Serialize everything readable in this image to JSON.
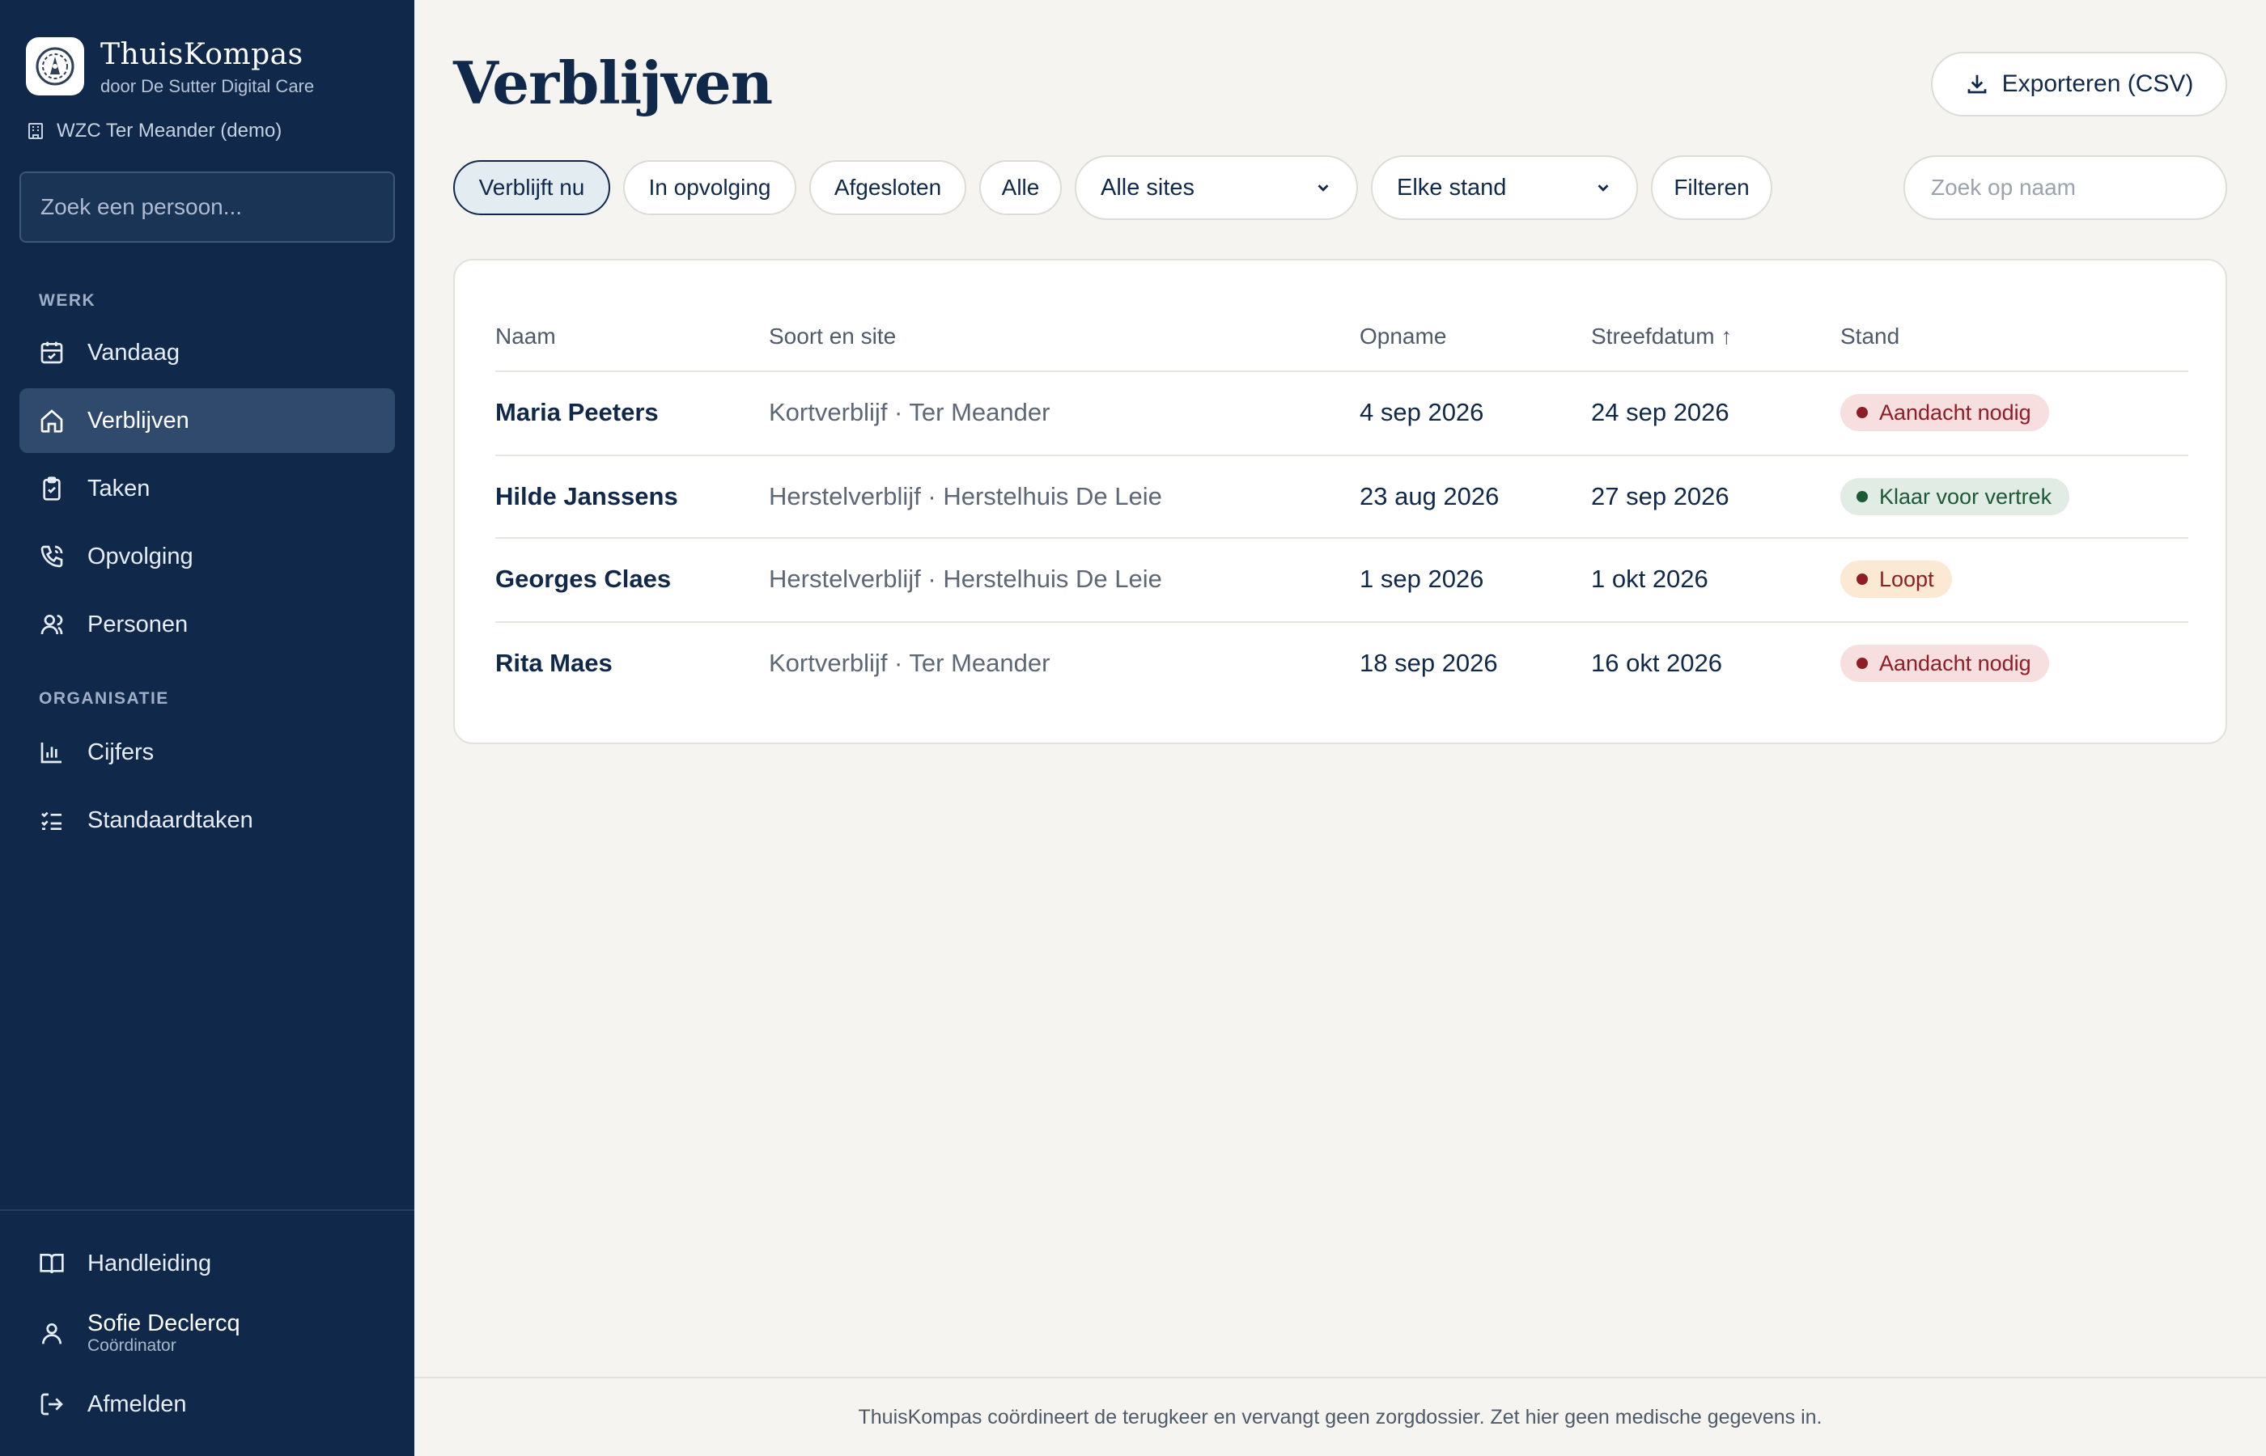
{
  "brand": {
    "title": "ThuisKompas",
    "subtitle": "door De Sutter Digital Care"
  },
  "org": {
    "name": "WZC Ter Meander (demo)"
  },
  "sidebar_search": {
    "placeholder": "Zoek een persoon..."
  },
  "nav": {
    "section_work": "WERK",
    "section_org": "ORGANISATIE",
    "items": [
      {
        "label": "Vandaag",
        "icon": "calendar-icon"
      },
      {
        "label": "Verblijven",
        "icon": "home-icon",
        "active": true
      },
      {
        "label": "Taken",
        "icon": "clipboard-icon"
      },
      {
        "label": "Opvolging",
        "icon": "phone-icon"
      },
      {
        "label": "Personen",
        "icon": "user-icon"
      },
      {
        "label": "Cijfers",
        "icon": "bar-chart-icon"
      },
      {
        "label": "Standaardtaken",
        "icon": "checklist-icon"
      }
    ],
    "manual": "Handleiding",
    "logout": "Afmelden"
  },
  "user": {
    "name": "Sofie Declercq",
    "role": "Coördinator"
  },
  "page": {
    "title": "Verblijven",
    "export_label": "Exporteren (CSV)"
  },
  "filters": {
    "pills": [
      "Verblijft nu",
      "In opvolging",
      "Afgesloten",
      "Alle"
    ],
    "active_pill": "Verblijft nu",
    "site_select": "Alle sites",
    "state_select": "Elke stand",
    "filter_button": "Filteren",
    "name_search_placeholder": "Zoek op naam"
  },
  "table": {
    "headers": [
      "Naam",
      "Soort en site",
      "Opname",
      "Streefdatum",
      "Stand"
    ],
    "sort_indicator": "↑",
    "rows": [
      {
        "naam": "Maria Peeters",
        "soort": "Kortverblijf · Ter Meander",
        "opname": "4 sep 2026",
        "streefdatum": "24 sep 2026",
        "stand": "Aandacht nodig",
        "stand_color": "#8f1d25"
      },
      {
        "naam": "Hilde Janssens",
        "soort": "Herstelverblijf · Herstelhuis De Leie",
        "opname": "23 aug 2026",
        "streefdatum": "27 sep 2026",
        "stand": "Klaar voor vertrek",
        "stand_color": "#1c5a34"
      },
      {
        "naam": "Georges Claes",
        "soort": "Herstelverblijf · Herstelhuis De Leie",
        "opname": "1 sep 2026",
        "streefdatum": "1 okt 2026",
        "stand": "Loopt",
        "stand_color": "#8f1d25"
      },
      {
        "naam": "Rita Maes",
        "soort": "Kortverblijf · Ter Meander",
        "opname": "18 sep 2026",
        "streefdatum": "16 okt 2026",
        "stand": "Aandacht nodig",
        "stand_color": "#8f1d25"
      }
    ]
  },
  "footer": {
    "text": "ThuisKompas coördineert de terugkeer en vervangt geen zorgdossier. Zet hier geen medische gegevens in."
  },
  "colors": {
    "sidebar": "#10294a",
    "background": "#f5f4f0",
    "accent": "#10294a"
  }
}
